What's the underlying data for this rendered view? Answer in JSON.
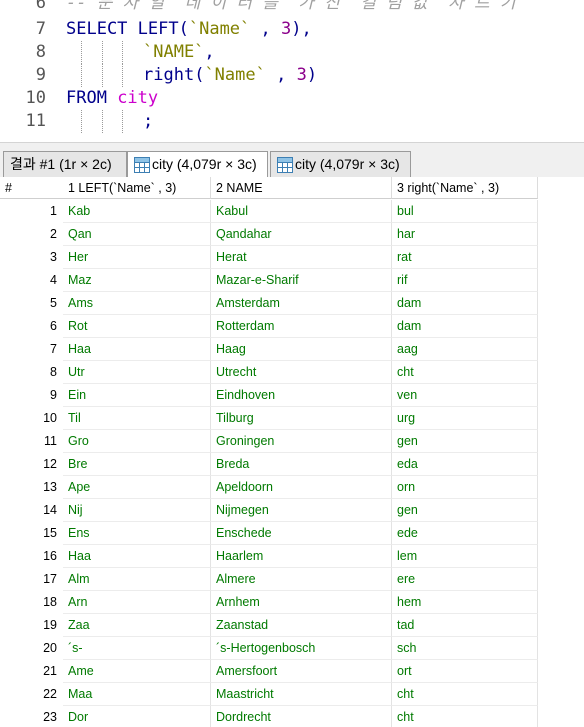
{
  "editor": {
    "lines": [
      {
        "num": "6",
        "tokens": [
          {
            "t": "-- 문 자 열  데 이 터 를  가 진  컬 럼 값  자 르 기",
            "c": "cm"
          }
        ]
      },
      {
        "num": "7",
        "tokens": [
          {
            "t": "SELECT ",
            "c": "kw"
          },
          {
            "t": "LEFT",
            "c": "fn"
          },
          {
            "t": "(",
            "c": "punc"
          },
          {
            "t": "`Name` ",
            "c": "str"
          },
          {
            "t": ", ",
            "c": "punc"
          },
          {
            "t": "3",
            "c": "num"
          },
          {
            "t": "),",
            "c": "punc"
          }
        ]
      },
      {
        "num": "8",
        "indent": true,
        "tokens": [
          {
            "t": "`NAME`",
            "c": "str"
          },
          {
            "t": ",",
            "c": "punc"
          }
        ]
      },
      {
        "num": "9",
        "indent": true,
        "tokens": [
          {
            "t": "right",
            "c": "fn"
          },
          {
            "t": "(",
            "c": "punc"
          },
          {
            "t": "`Name` ",
            "c": "str"
          },
          {
            "t": ", ",
            "c": "punc"
          },
          {
            "t": "3",
            "c": "num"
          },
          {
            "t": ")",
            "c": "punc"
          }
        ]
      },
      {
        "num": "10",
        "tokens": [
          {
            "t": "FROM ",
            "c": "kw"
          },
          {
            "t": "city",
            "c": "pink"
          }
        ]
      },
      {
        "num": "11",
        "indent": true,
        "tokens": [
          {
            "t": ";",
            "c": "punc"
          }
        ]
      }
    ]
  },
  "tabs": [
    {
      "label": "결과 #1 (1r × 2c)",
      "icon": "none",
      "active": false
    },
    {
      "label": "city (4,079r × 3c)",
      "icon": "table-grid-icon",
      "active": true
    },
    {
      "label": "city (4,079r × 3c)",
      "icon": "table-grid-icon",
      "active": false
    }
  ],
  "grid": {
    "columns": [
      "#",
      "1 LEFT(`Name` , 3)",
      "2 NAME",
      "3 right(`Name` , 3)"
    ],
    "rows": [
      [
        "1",
        "Kab",
        "Kabul",
        "bul"
      ],
      [
        "2",
        "Qan",
        "Qandahar",
        "har"
      ],
      [
        "3",
        "Her",
        "Herat",
        "rat"
      ],
      [
        "4",
        "Maz",
        "Mazar-e-Sharif",
        "rif"
      ],
      [
        "5",
        "Ams",
        "Amsterdam",
        "dam"
      ],
      [
        "6",
        "Rot",
        "Rotterdam",
        "dam"
      ],
      [
        "7",
        "Haa",
        "Haag",
        "aag"
      ],
      [
        "8",
        "Utr",
        "Utrecht",
        "cht"
      ],
      [
        "9",
        "Ein",
        "Eindhoven",
        "ven"
      ],
      [
        "10",
        "Til",
        "Tilburg",
        "urg"
      ],
      [
        "11",
        "Gro",
        "Groningen",
        "gen"
      ],
      [
        "12",
        "Bre",
        "Breda",
        "eda"
      ],
      [
        "13",
        "Ape",
        "Apeldoorn",
        "orn"
      ],
      [
        "14",
        "Nij",
        "Nijmegen",
        "gen"
      ],
      [
        "15",
        "Ens",
        "Enschede",
        "ede"
      ],
      [
        "16",
        "Haa",
        "Haarlem",
        "lem"
      ],
      [
        "17",
        "Alm",
        "Almere",
        "ere"
      ],
      [
        "18",
        "Arn",
        "Arnhem",
        "hem"
      ],
      [
        "19",
        "Zaa",
        "Zaanstad",
        "tad"
      ],
      [
        "20",
        "´s-",
        "´s-Hertogenbosch",
        "sch"
      ],
      [
        "21",
        "Ame",
        "Amersfoort",
        "ort"
      ],
      [
        "22",
        "Maa",
        "Maastricht",
        "cht"
      ],
      [
        "23",
        "Dor",
        "Dordrecht",
        "cht"
      ]
    ]
  }
}
